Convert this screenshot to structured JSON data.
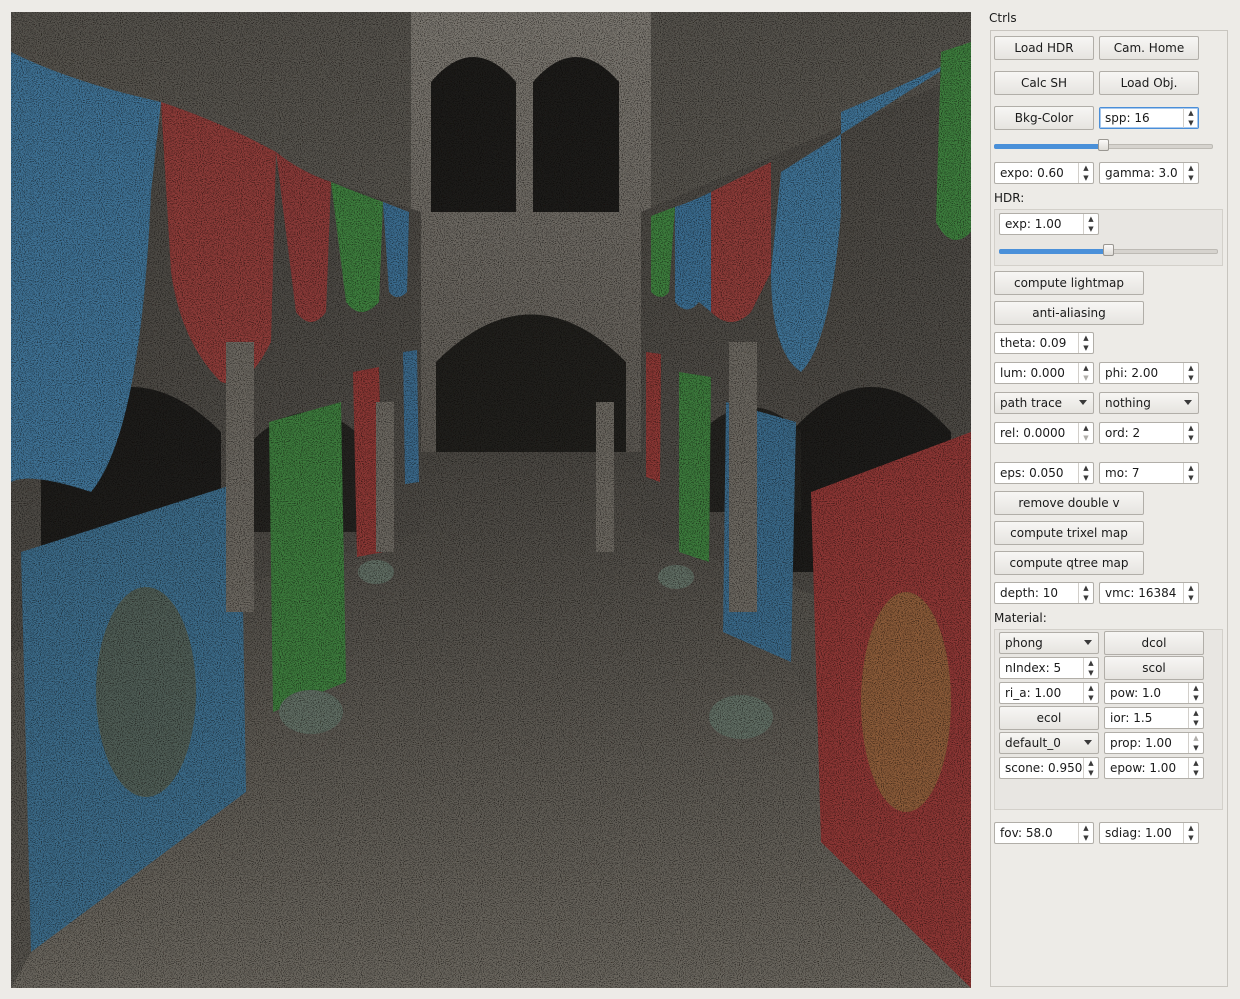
{
  "panel": {
    "title": "Ctrls",
    "buttons": {
      "load_hdr": "Load HDR",
      "cam_home": "Cam. Home",
      "calc_sh": "Calc SH",
      "load_obj": "Load Obj.",
      "bkg_color": "Bkg-Color",
      "compute_lightmap": "compute lightmap",
      "anti_aliasing": "anti-aliasing",
      "remove_double_v": "remove double v",
      "compute_trixel_map": "compute trixel map",
      "compute_qtree_map": "compute qtree map"
    },
    "spp": "spp: 16",
    "spp_slider_level": 0.5,
    "expo": "expo: 0.60",
    "gamma": "gamma: 3.0",
    "hdr": {
      "label": "HDR:",
      "exp": "exp: 1.00",
      "exp_slider_level": 0.5
    },
    "theta": "theta: 0.09",
    "lum": "lum: 0.000",
    "phi": "phi: 2.00",
    "render_mode": "path trace",
    "overlay_mode": "nothing",
    "rel": "rel: 0.0000",
    "ord": "ord: 2",
    "eps": "eps: 0.050",
    "mo": "mo: 7",
    "depth": "depth: 10",
    "vmc": "vmc: 16384",
    "material": {
      "label": "Material:",
      "shader": "phong",
      "dcol": "dcol",
      "nindex": "nIndex: 5",
      "scol": "scol",
      "ri_a": "ri_a: 1.00",
      "pow": "pow: 1.0",
      "ecol": "ecol",
      "ior": "ior: 1.5",
      "material_name": "default_0",
      "prop": "prop: 1.00",
      "scone": "scone: 0.950",
      "epow": "epow: 1.00"
    },
    "fov": "fov: 58.0",
    "sdiag": "sdiag: 1.00"
  },
  "colors": {
    "accent": "#4a90d9",
    "banner_blue": "#3d6e8c",
    "banner_red": "#8e3a36",
    "banner_green": "#3e7b3e",
    "stone": "#5a5650"
  }
}
